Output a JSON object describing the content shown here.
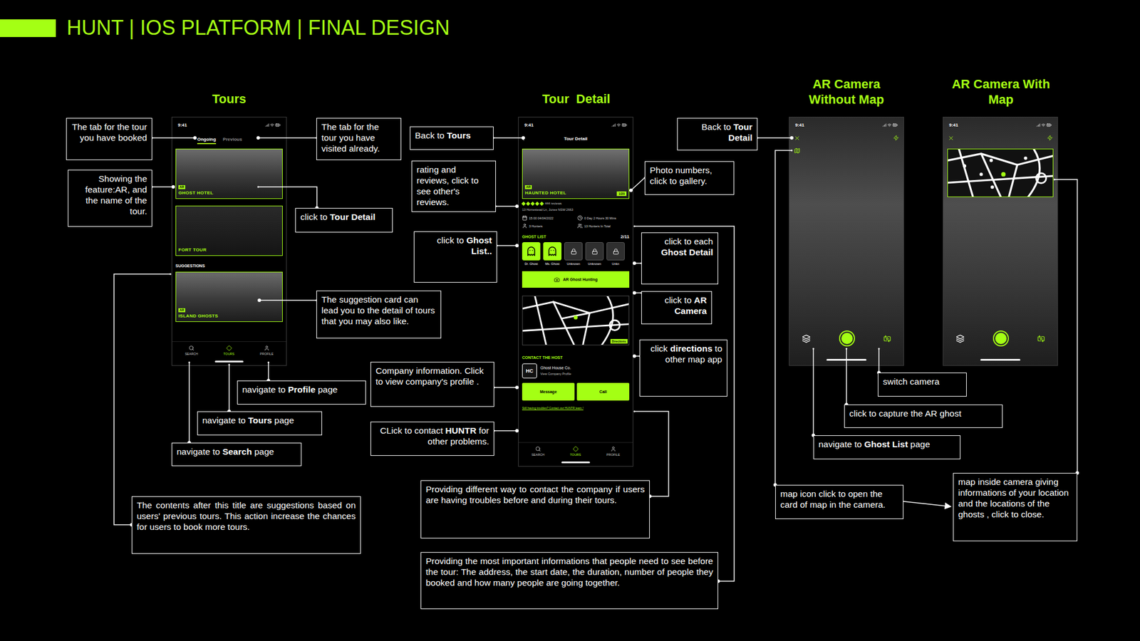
{
  "header": {
    "title": "HUNT | IOS PLATFORM | FINAL DESIGN"
  },
  "sections": [
    {
      "lines": [
        "Tours"
      ]
    },
    {
      "lines": [
        "Tour  Detail"
      ]
    },
    {
      "lines": [
        "AR Camera",
        "Without Map"
      ]
    },
    {
      "lines": [
        "AR Camera With",
        "Map"
      ]
    }
  ],
  "tours_screen": {
    "time": "9:41",
    "tabs": [
      {
        "label": "Ongoing",
        "selected": true
      },
      {
        "label": "Previous",
        "selected": false
      }
    ],
    "cards": [
      {
        "badge": "AR",
        "name": "GHOST HOTEL"
      },
      {
        "name": "FORT TOUR"
      }
    ],
    "suggestions_title": "SUGGESTIONS",
    "suggestions": [
      {
        "badge": "AR",
        "name": "ISLAND GHOSTS"
      }
    ],
    "nav": [
      {
        "label": "SEARCH",
        "selected": false
      },
      {
        "label": "TOURS",
        "selected": true
      },
      {
        "label": "PROFILE",
        "selected": false
      }
    ]
  },
  "detail_screen": {
    "time": "9:41",
    "title": "Tour Detail",
    "tour": {
      "badge": "AR",
      "name": "HAUNTED HOTEL",
      "photo_count": "1/20"
    },
    "stars": 5,
    "reviews": "444 reviews",
    "address": "13 Homestead Ln, Junee NSW 2663",
    "info": [
      "15:00 04/04/2022",
      "0 Day 2 Hours 30 Mins",
      "3 Hunters",
      "13 Hunters In Total"
    ],
    "ghost_list": {
      "title": "GHOST LIST",
      "count": "2/11",
      "ghosts": [
        {
          "name": "Dr. Ghost",
          "unlocked": true
        },
        {
          "name": "Ms. Ghost",
          "unlocked": true
        },
        {
          "name": "Unknown",
          "unlocked": false
        },
        {
          "name": "Unknown",
          "unlocked": false
        },
        {
          "name": "Unkn",
          "unlocked": false
        }
      ]
    },
    "ar_button": "AR Ghost Hunting",
    "map_button": "Directions",
    "contact": {
      "title": "CONTACT THE HOST",
      "company": "Ghost House Co.",
      "link": "View Company Profile",
      "logo": "HC"
    },
    "buttons": [
      "Message",
      "Call"
    ],
    "help": "Still having troubles? Contact our HUNTR team !",
    "nav": [
      {
        "label": "SEARCH",
        "selected": false
      },
      {
        "label": "TOURS",
        "selected": true
      },
      {
        "label": "PROFILE",
        "selected": false
      }
    ]
  },
  "ar_screens": [
    {
      "time": "9:41",
      "map_open": false
    },
    {
      "time": "9:41",
      "map_open": true
    }
  ],
  "annotations": [
    [
      {
        "text": "The tab for the tour you have booked",
        "bold": false
      }
    ],
    [
      {
        "text": "Showing the feature:AR, and the name of the tour.",
        "bold": false
      }
    ],
    [
      {
        "text": "The tab for the tour you have visited already.",
        "bold": false
      }
    ],
    [
      {
        "text": "click to ",
        "bold": false
      },
      {
        "text": "Tour Detail",
        "bold": true
      }
    ],
    [
      {
        "text": "The suggestion card can lead you to the detail of tours that you may also like.",
        "bold": false
      }
    ],
    [
      {
        "text": "The contents after this title are suggestions based on users' previous tours. This action increase the chances for users to book more tours.",
        "bold": false
      }
    ],
    [
      {
        "text": "navigate to ",
        "bold": false
      },
      {
        "text": "Profile",
        "bold": true
      },
      {
        "text": " page",
        "bold": false
      }
    ],
    [
      {
        "text": "navigate to ",
        "bold": false
      },
      {
        "text": "Tours",
        "bold": true
      },
      {
        "text": " page",
        "bold": false
      }
    ],
    [
      {
        "text": "navigate to ",
        "bold": false
      },
      {
        "text": "Search",
        "bold": true
      },
      {
        "text": " page",
        "bold": false
      }
    ],
    [
      {
        "text": "Back to ",
        "bold": false
      },
      {
        "text": "Tours",
        "bold": true
      }
    ],
    [
      {
        "text": "rating and reviews, click to see other's reviews.",
        "bold": false
      }
    ],
    [
      {
        "text": "click to ",
        "bold": false
      },
      {
        "text": "Ghost List..",
        "bold": true
      }
    ],
    [
      {
        "text": "Company information. Click to view company's profile .",
        "bold": false
      }
    ],
    [
      {
        "text": "CLick to contact ",
        "bold": false
      },
      {
        "text": "HUNTR",
        "bold": true
      },
      {
        "text": " for other problems.",
        "bold": false
      }
    ],
    [
      {
        "text": "Photo numbers, click to gallery.",
        "bold": false
      }
    ],
    [
      {
        "text": "click to each ",
        "bold": false
      },
      {
        "text": "Ghost Detail",
        "bold": true
      }
    ],
    [
      {
        "text": "click to ",
        "bold": false
      },
      {
        "text": "AR Camera",
        "bold": true
      }
    ],
    [
      {
        "text": "click ",
        "bold": false
      },
      {
        "text": "directions",
        "bold": true
      },
      {
        "text": " to other map app",
        "bold": false
      }
    ],
    [
      {
        "text": "Providing different way to contact the company if users are having troubles before and during their tours.",
        "bold": false
      }
    ],
    [
      {
        "text": "Providing the most important informations that people need to see before the tour: The address, the start date, the duration, number of people they booked and how many people are going together.",
        "bold": false
      }
    ],
    [
      {
        "text": "Back to ",
        "bold": false
      },
      {
        "text": "Tour Detail",
        "bold": true
      }
    ],
    [
      {
        "text": "switch camera",
        "bold": false
      }
    ],
    [
      {
        "text": "click to capture the AR ghost",
        "bold": false
      }
    ],
    [
      {
        "text": "navigate to ",
        "bold": false
      },
      {
        "text": "Ghost List",
        "bold": true
      },
      {
        "text": " page",
        "bold": false
      }
    ],
    [
      {
        "text": "map icon click to open the card of map in the camera.",
        "bold": false
      }
    ],
    [
      {
        "text": "map inside camera giving informations of your location and the locations of the ghosts , click to close.",
        "bold": false
      }
    ]
  ]
}
